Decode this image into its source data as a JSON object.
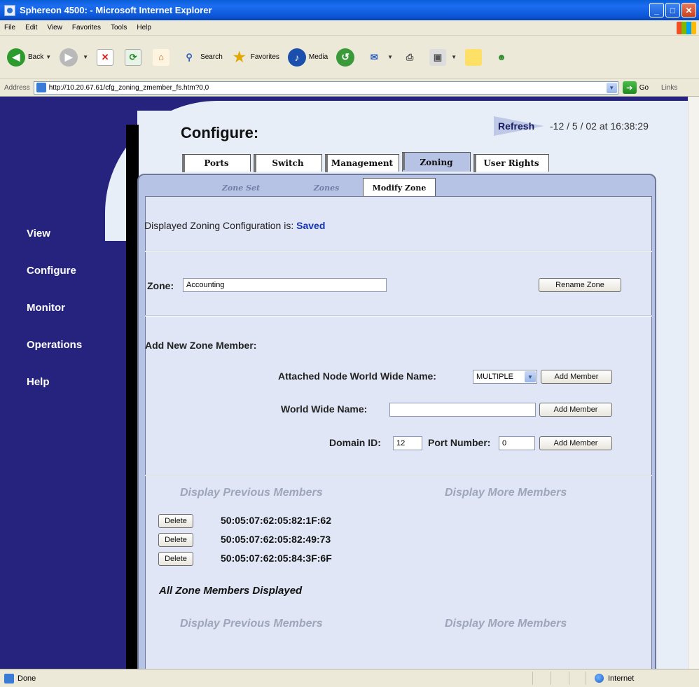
{
  "window": {
    "title": "Sphereon 4500: - Microsoft Internet Explorer"
  },
  "menu": [
    "File",
    "Edit",
    "View",
    "Favorites",
    "Tools",
    "Help"
  ],
  "toolbar": {
    "back": "Back",
    "search": "Search",
    "favorites": "Favorites",
    "media": "Media"
  },
  "address": {
    "label": "Address",
    "url": "http://10.20.67.61/cfg_zoning_zmember_fs.htm?0,0",
    "go": "Go",
    "links": "Links"
  },
  "nav": [
    "View",
    "Configure",
    "Monitor",
    "Operations",
    "Help"
  ],
  "page": {
    "title": "Configure:",
    "refresh": "Refresh",
    "timestamp": "-12 / 5 / 02 at 16:38:29"
  },
  "tabs": [
    "Ports",
    "Switch",
    "Management",
    "Zoning",
    "User Rights"
  ],
  "subtabs": [
    "Zone Set",
    "Zones",
    "Modify Zone"
  ],
  "status": {
    "prefix": "Displayed Zoning Configuration is:",
    "value": "Saved"
  },
  "zone": {
    "label": "Zone:",
    "value": "Accounting",
    "rename": "Rename Zone"
  },
  "add_member": {
    "heading": "Add New Zone Member:",
    "attached_label": "Attached Node World Wide Name:",
    "attached_value": "MULTIPLE",
    "wwn_label": "World Wide Name:",
    "wwn_value": "",
    "domain_label": "Domain ID:",
    "domain_value": "12",
    "port_label": "Port Number:",
    "port_value": "0",
    "add_button": "Add Member"
  },
  "members": {
    "prev": "Display Previous Members",
    "more": "Display More Members",
    "delete": "Delete",
    "list": [
      "50:05:07:62:05:82:1F:62",
      "50:05:07:62:05:82:49:73",
      "50:05:07:62:05:84:3F:6F"
    ],
    "all_displayed": "All Zone Members Displayed"
  },
  "statusbar": {
    "left": "Done",
    "zone": "Internet"
  }
}
